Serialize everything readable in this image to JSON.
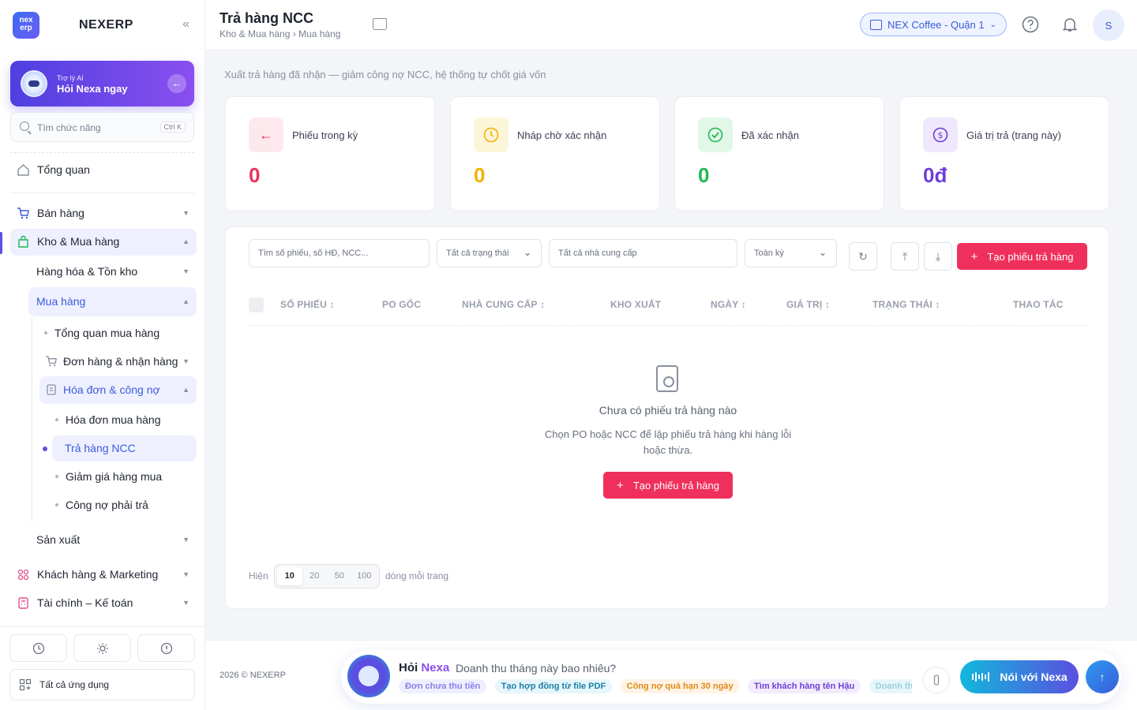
{
  "brand": {
    "name": "NEXERP",
    "logo_text": "nex erp"
  },
  "ai_card": {
    "small": "Trợ lý AI",
    "big": "Hỏi Nexa ngay"
  },
  "search": {
    "placeholder": "Tìm chức năng",
    "shortcut": "Ctrl K"
  },
  "sidebar": {
    "overview": "Tổng quan",
    "sales": "Bán hàng",
    "warehouse": "Kho & Mua hàng",
    "goods": "Hàng hóa & Tồn kho",
    "purchasing": "Mua hàng",
    "purchasing_overview": "Tổng quan mua hàng",
    "orders": "Đơn hàng & nhận hàng",
    "invoices": "Hóa đơn & công nợ",
    "purchase_invoices": "Hóa đơn mua hàng",
    "supplier_returns": "Trả hàng NCC",
    "discounts": "Giảm giá hàng mua",
    "payables": "Công nợ phải trả",
    "production": "Sản xuất",
    "crm": "Khách hàng & Marketing",
    "finance": "Tài chính – Kế toán",
    "all_apps": "Tất cả ứng dụng"
  },
  "header": {
    "title": "Trả hàng NCC",
    "breadcrumb": "Kho & Mua hàng › Mua hàng",
    "store": "NEX Coffee - Quận 1",
    "avatar": "S"
  },
  "subtitle": "Xuất trả hàng đã nhận — giảm công nợ NCC, hệ thống tự chốt giá vốn",
  "stats": [
    {
      "label": "Phiếu trong kỳ",
      "value": "0",
      "color": "#f0305c"
    },
    {
      "label": "Nháp chờ xác nhận",
      "value": "0",
      "color": "#f2b200"
    },
    {
      "label": "Đã xác nhận",
      "value": "0",
      "color": "#1fb954"
    },
    {
      "label": "Giá trị trả (trang này)",
      "value": "0đ",
      "color": "#6d3fd8"
    }
  ],
  "filters": {
    "search_placeholder": "Tìm số phiếu, số HĐ, NCC...",
    "status": "Tất cả trạng thái",
    "supplier": "Tất cả nhà cung cấp",
    "period": "Toàn kỳ",
    "create": "Tạo phiếu trả hàng"
  },
  "table": {
    "columns": [
      "SỐ PHIẾU",
      "PO GỐC",
      "NHÀ CUNG CẤP",
      "KHO XUẤT",
      "NGÀY",
      "GIÁ TRỊ",
      "TRẠNG THÁI",
      "THAO TÁC"
    ]
  },
  "empty": {
    "title": "Chưa có phiếu trả hàng nào",
    "desc": "Chọn PO hoặc NCC để lập phiếu trả hàng khi hàng lỗi hoặc thừa.",
    "button": "Tạo phiếu trả hàng"
  },
  "pager": {
    "prefix": "Hiện",
    "suffix": "dòng mỗi trang",
    "options": [
      "10",
      "20",
      "50",
      "100"
    ],
    "selected": "10"
  },
  "footer": {
    "copyright": "2026 © NEXERP",
    "ask_prefix": "Hỏi",
    "ask_name": "Nexa",
    "question": "Doanh thu tháng này bao nhiêu?",
    "chips": [
      "Đơn chưa thu tiền",
      "Tạo hợp đồng từ file PDF",
      "Công nợ quá hạn 30 ngày",
      "Tìm khách hàng tên Hậu",
      "Doanh thu"
    ],
    "talk": "Nói với Nexa"
  }
}
